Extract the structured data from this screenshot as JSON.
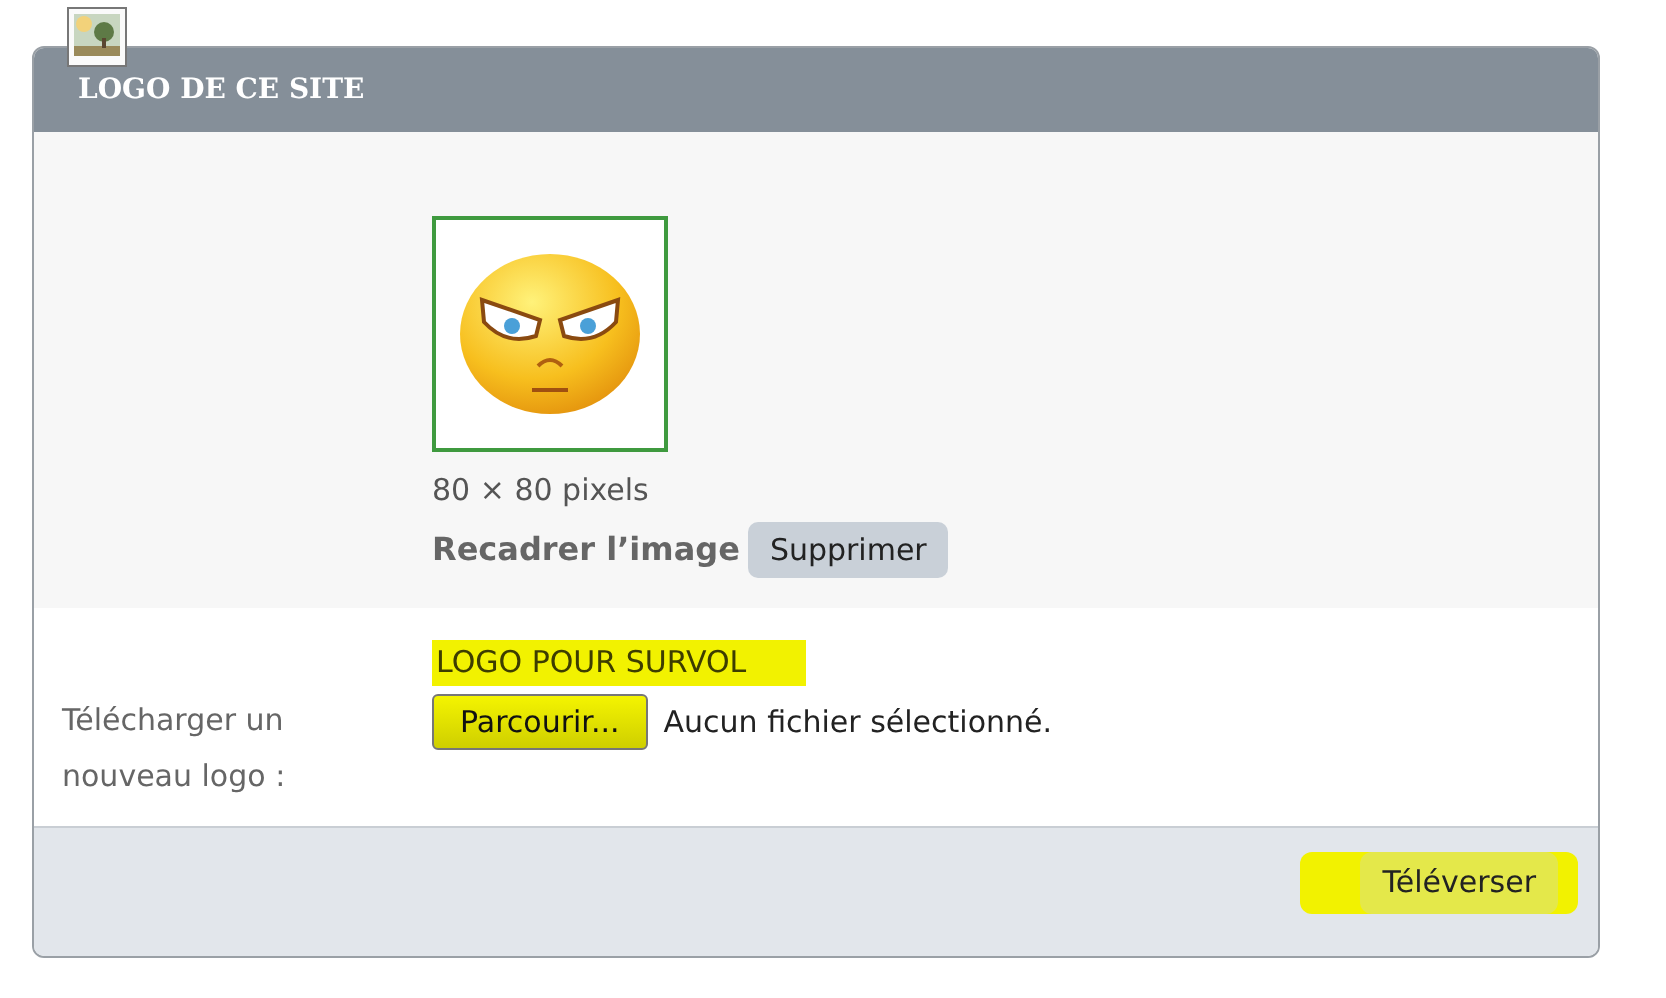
{
  "panel": {
    "title": "LOGO DE CE SITE"
  },
  "current_logo": {
    "size": "80 × 80 pixels",
    "crop_label": "Recadrer l’image",
    "delete_button": "Supprimer"
  },
  "upload": {
    "label": "Télécharger un nouveau logo :",
    "hover_title": {
      "text": "LOGO POUR SURVOL",
      "highlighted": true
    },
    "browse_button": {
      "text": "Parcourir...",
      "highlighted": true
    },
    "file_status": "Aucun fichier sélectionné."
  },
  "footer": {
    "submit_button": {
      "text": "Téléverser",
      "highlighted": true
    }
  }
}
